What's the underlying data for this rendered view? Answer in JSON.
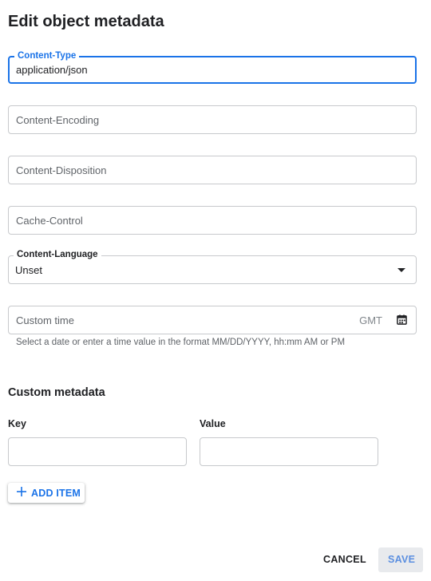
{
  "dialog": {
    "title": "Edit object metadata"
  },
  "fields": {
    "content_type": {
      "label": "Content-Type",
      "value": "application/json"
    },
    "content_encoding": {
      "placeholder": "Content-Encoding"
    },
    "content_disposition": {
      "placeholder": "Content-Disposition"
    },
    "cache_control": {
      "placeholder": "Cache-Control"
    },
    "content_language": {
      "label": "Content-Language",
      "value": "Unset"
    },
    "custom_time": {
      "placeholder": "Custom time",
      "suffix": "GMT",
      "icon": "calendar-icon",
      "hint": "Select a date or enter a time value in the format MM/DD/YYYY, hh:mm AM or PM"
    }
  },
  "custom_metadata": {
    "title": "Custom metadata",
    "key_label": "Key",
    "value_label": "Value",
    "key_value": "",
    "value_value": "",
    "add_item_label": "ADD ITEM",
    "add_icon": "plus-icon"
  },
  "actions": {
    "cancel_label": "CANCEL",
    "save_label": "SAVE"
  },
  "colors": {
    "accent": "#1a73e8",
    "border": "#c7c9cc",
    "save_bg": "#e8eaed"
  }
}
